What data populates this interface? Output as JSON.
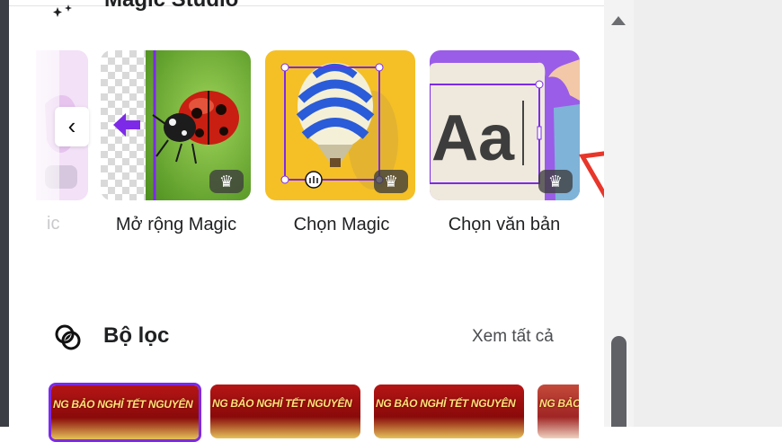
{
  "magic_studio": {
    "title": "Magic Studio",
    "prev_label": "‹",
    "partial_label": "ic",
    "cards": [
      {
        "label": "Mở rộng Magic",
        "premium_icon": "crown-icon",
        "badge": "♛"
      },
      {
        "label": "Chọn Magic",
        "premium_icon": "crown-icon",
        "badge": "♛"
      },
      {
        "label": "Chọn văn bản",
        "premium_icon": "crown-icon",
        "badge": "♛",
        "preview_text": "Aa"
      }
    ]
  },
  "filters": {
    "title": "Bộ lọc",
    "see_all": "Xem tất cả",
    "thumb_text": "NG BẢO NGHỈ TẾT NGUYÊN"
  },
  "colors": {
    "accent": "#7d2ae8",
    "arrow": "#e8362a",
    "scroll_thumb": "#5f6166"
  }
}
